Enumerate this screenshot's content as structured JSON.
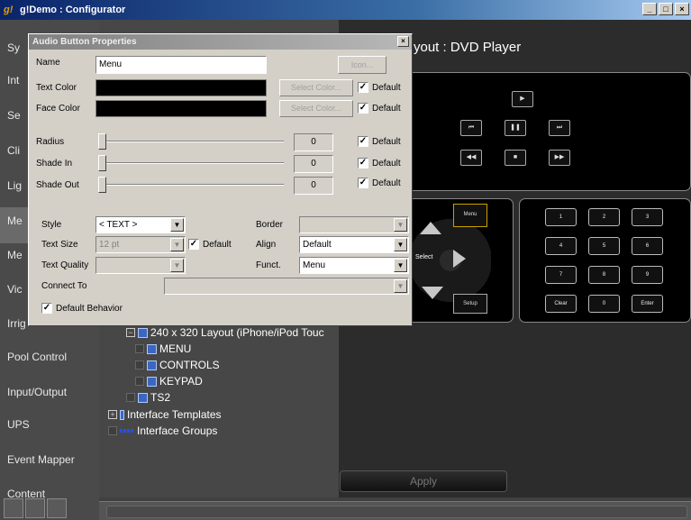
{
  "window": {
    "title": "g!Demo : Configurator",
    "icon": "app-logo-icon"
  },
  "sidebar": {
    "items": [
      {
        "label": "Sy"
      },
      {
        "label": "Int"
      },
      {
        "label": "Se"
      },
      {
        "label": "Cli"
      },
      {
        "label": "Lig"
      },
      {
        "label": "Me"
      },
      {
        "label": "Me"
      },
      {
        "label": "Vic"
      },
      {
        "label": "Irrig"
      },
      {
        "label": "Pool Control"
      },
      {
        "label": "Input/Output"
      },
      {
        "label": "UPS"
      },
      {
        "label": "Event Mapper"
      },
      {
        "label": "Content"
      }
    ]
  },
  "tree": {
    "items": [
      {
        "label": "240 x 320 Layout (iPhone/iPod Touc"
      },
      {
        "label": "MENU"
      },
      {
        "label": "CONTROLS"
      },
      {
        "label": "KEYPAD"
      },
      {
        "label": "TS2"
      },
      {
        "label": "Interface Templates"
      },
      {
        "label": "Interface Groups"
      }
    ]
  },
  "preview": {
    "title": "yout : DVD Player",
    "transport": [
      "▶",
      "⏮",
      "❚❚",
      "⏭",
      "◀◀",
      "■",
      "▶▶"
    ],
    "menu_label": "Menu",
    "select_label": "Select",
    "setup_label": "Setup",
    "keypad": [
      "1",
      "2",
      "3",
      "4",
      "5",
      "6",
      "7",
      "8",
      "9",
      "Clear",
      "0",
      "Enter"
    ],
    "apply_label": "Apply"
  },
  "dialog": {
    "title": "Audio Button Properties",
    "name_label": "Name",
    "name_value": "Menu",
    "icon_button": "Icon...",
    "text_color_label": "Text Color",
    "face_color_label": "Face Color",
    "select_color": "Select Color...",
    "default_label": "Default",
    "radius_label": "Radius",
    "radius_value": "0",
    "shade_in_label": "Shade In",
    "shade_in_value": "0",
    "shade_out_label": "Shade Out",
    "shade_out_value": "0",
    "style_label": "Style",
    "style_value": "< TEXT >",
    "text_size_label": "Text Size",
    "text_size_value": "12 pt",
    "text_quality_label": "Text Quality",
    "text_quality_value": "",
    "connect_to_label": "Connect To",
    "border_label": "Border",
    "border_value": "",
    "align_label": "Align",
    "align_value": "Default",
    "funct_label": "Funct.",
    "funct_value": "Menu",
    "default_behavior_label": "Default Behavior"
  }
}
